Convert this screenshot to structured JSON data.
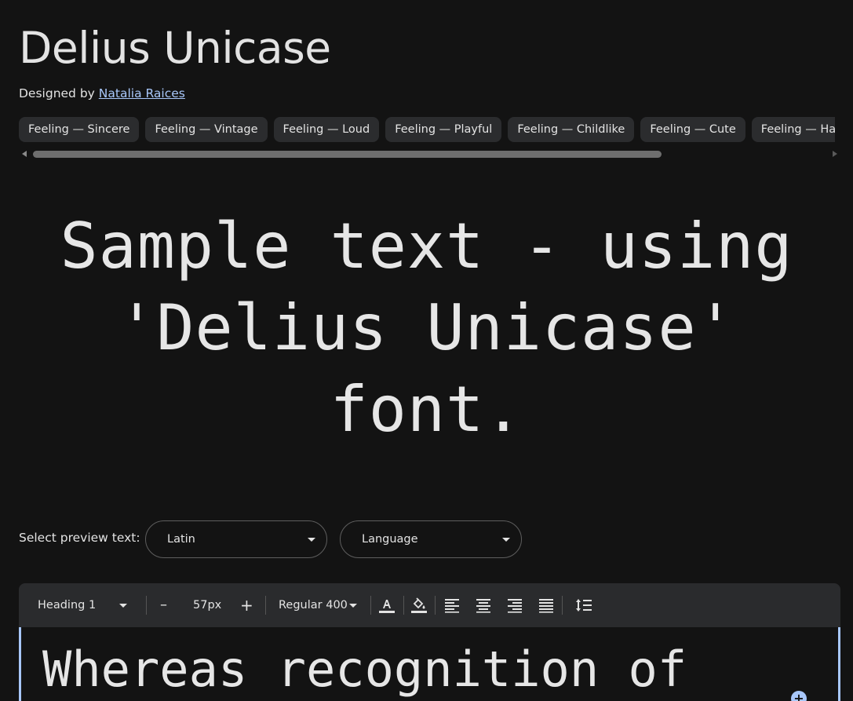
{
  "font": {
    "title": "Delius Unicase",
    "designed_by_label": "Designed by",
    "designer_name": "Natalia Raices"
  },
  "tags": [
    "Feeling — Sincere",
    "Feeling — Vintage",
    "Feeling — Loud",
    "Feeling — Playful",
    "Feeling — Childlike",
    "Feeling — Cute",
    "Feeling — Happy"
  ],
  "sample": {
    "line1": "Sample text - using",
    "line2": "'Delius Unicase'",
    "line3": "font."
  },
  "preview": {
    "label": "Select preview text:",
    "script_value": "Latin",
    "language_placeholder": "Language"
  },
  "toolbar": {
    "style_value": "Heading 1",
    "decrease_label": "–",
    "size_value": "57px",
    "increase_label": "+",
    "weight_value": "Regular 400"
  },
  "editor": {
    "text": "Whereas recognition of"
  },
  "colors": {
    "background": "#131313",
    "chip": "#2b2c2e",
    "accent": "#a8c7fa",
    "text": "#e3e3e3"
  }
}
